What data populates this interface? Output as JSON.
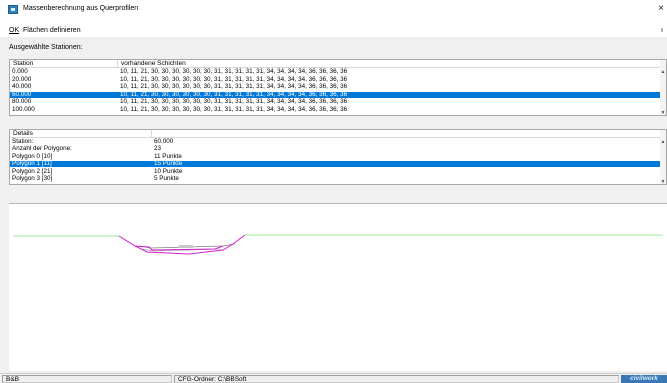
{
  "window": {
    "title": "Massenberechnung aus Querprofilen",
    "close_glyph": "×",
    "icon": "app-icon"
  },
  "menu": {
    "ok": "OK",
    "flaechen": "Flächen definieren",
    "right_glyph": "ı"
  },
  "stations": {
    "label": "Ausgewählte Stationen:",
    "columns": [
      "Station",
      "vorhandene Schichten"
    ],
    "rows": [
      {
        "station": "0.000",
        "layers": "10, 11, 21, 30, 30, 30, 30, 30, 30, 31, 31, 31, 31, 31, 34, 34, 34, 34, 36, 36, 36, 36",
        "selected": false
      },
      {
        "station": "20.000",
        "layers": "10, 11, 21, 30, 30, 30, 30, 30, 30, 31, 31, 31, 31, 31, 34, 34, 34, 34, 36, 36, 36, 36",
        "selected": false
      },
      {
        "station": "40.000",
        "layers": "10, 11, 21, 30, 30, 30, 30, 30, 30, 31, 31, 31, 31, 31, 34, 34, 34, 34, 36, 36, 36, 36",
        "selected": false
      },
      {
        "station": "60.000",
        "layers": "10, 11, 21, 30, 30, 30, 30, 30, 30, 31, 31, 31, 31, 31, 34, 34, 34, 34, 36, 36, 36, 36",
        "selected": true
      },
      {
        "station": "80.000",
        "layers": "10, 11, 21, 30, 30, 30, 30, 30, 30, 31, 31, 31, 31, 31, 34, 34, 34, 34, 36, 36, 36, 36",
        "selected": false
      },
      {
        "station": "100.000",
        "layers": "10, 11, 21, 30, 30, 30, 30, 30, 30, 31, 31, 31, 31, 31, 34, 34, 34, 34, 36, 36, 36, 36",
        "selected": false
      }
    ]
  },
  "details": {
    "columns": [
      "Details",
      ""
    ],
    "rows": [
      {
        "key": "Station:",
        "value": "60.000",
        "selected": false
      },
      {
        "key": "Anzahl der Polygone:",
        "value": "23",
        "selected": false
      },
      {
        "key": "Polygon 0 [10]",
        "value": "11 Punkte",
        "selected": false
      },
      {
        "key": "Polygon 1 [11]",
        "value": "15 Punkte",
        "selected": true
      },
      {
        "key": "Polygon 2 [21]",
        "value": "10 Punkte",
        "selected": false
      },
      {
        "key": "Polygon 3 [30]",
        "value": "5 Punkte",
        "selected": false
      }
    ]
  },
  "statusbar": {
    "left": "B&B",
    "middle": "CFG-Ordner: C:\\BBSoft",
    "logo": "civilwork"
  },
  "colors": {
    "selection": "#0078d7",
    "terrain_line": "#7fe07f",
    "polygon": "#d020d0",
    "layers": "#808080"
  }
}
